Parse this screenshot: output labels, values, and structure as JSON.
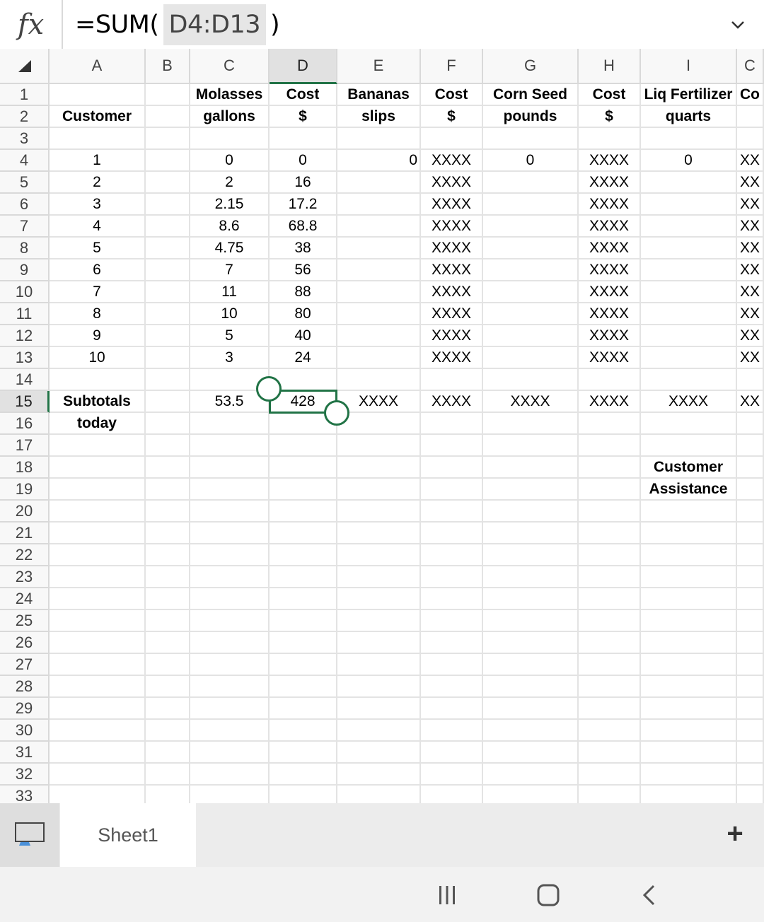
{
  "formula_bar": {
    "fx_label": "fx",
    "formula_prefix": "=SUM(",
    "formula_ref": "D4:D13",
    "formula_suffix": ")",
    "expand_icon": "chevron-down-icon"
  },
  "columns": [
    "A",
    "B",
    "C",
    "D",
    "E",
    "F",
    "G",
    "H",
    "I",
    "C"
  ],
  "selected_column": "D",
  "rows": [
    "1",
    "2",
    "3",
    "4",
    "5",
    "6",
    "7",
    "8",
    "9",
    "10",
    "11",
    "12",
    "13",
    "14",
    "15",
    "16",
    "17",
    "18",
    "19",
    "20",
    "21",
    "22",
    "23",
    "24",
    "25",
    "26",
    "27",
    "28",
    "29",
    "30",
    "31",
    "32",
    "33"
  ],
  "selected_row": "15",
  "headers": {
    "row1": [
      "",
      "",
      "Molasses",
      "Cost",
      "Bananas",
      "Cost",
      "Corn Seed",
      "Cost",
      "Liq Fertilizer",
      "Co"
    ],
    "row2": [
      "Customer",
      "",
      "gallons",
      "$",
      "slips",
      "$",
      "pounds",
      "$",
      "quarts",
      ""
    ]
  },
  "data_rows": [
    {
      "customer": "1",
      "molasses": "0",
      "cost": "0",
      "bananas": "0",
      "f": "XXXX",
      "corn": "0",
      "h": "XXXX",
      "liq": "0",
      "j": "XX"
    },
    {
      "customer": "2",
      "molasses": "2",
      "cost": "16",
      "bananas": "",
      "f": "XXXX",
      "corn": "",
      "h": "XXXX",
      "liq": "",
      "j": "XX"
    },
    {
      "customer": "3",
      "molasses": "2.15",
      "cost": "17.2",
      "bananas": "",
      "f": "XXXX",
      "corn": "",
      "h": "XXXX",
      "liq": "",
      "j": "XX"
    },
    {
      "customer": "4",
      "molasses": "8.6",
      "cost": "68.8",
      "bananas": "",
      "f": "XXXX",
      "corn": "",
      "h": "XXXX",
      "liq": "",
      "j": "XX"
    },
    {
      "customer": "5",
      "molasses": "4.75",
      "cost": "38",
      "bananas": "",
      "f": "XXXX",
      "corn": "",
      "h": "XXXX",
      "liq": "",
      "j": "XX"
    },
    {
      "customer": "6",
      "molasses": "7",
      "cost": "56",
      "bananas": "",
      "f": "XXXX",
      "corn": "",
      "h": "XXXX",
      "liq": "",
      "j": "XX"
    },
    {
      "customer": "7",
      "molasses": "11",
      "cost": "88",
      "bananas": "",
      "f": "XXXX",
      "corn": "",
      "h": "XXXX",
      "liq": "",
      "j": "XX"
    },
    {
      "customer": "8",
      "molasses": "10",
      "cost": "80",
      "bananas": "",
      "f": "XXXX",
      "corn": "",
      "h": "XXXX",
      "liq": "",
      "j": "XX"
    },
    {
      "customer": "9",
      "molasses": "5",
      "cost": "40",
      "bananas": "",
      "f": "XXXX",
      "corn": "",
      "h": "XXXX",
      "liq": "",
      "j": "XX"
    },
    {
      "customer": "10",
      "molasses": "3",
      "cost": "24",
      "bananas": "",
      "f": "XXXX",
      "corn": "",
      "h": "XXXX",
      "liq": "",
      "j": "XX"
    }
  ],
  "subtotals": {
    "label1": "Subtotals",
    "label2": "today",
    "values": [
      "53.5",
      "428",
      "XXXX",
      "XXXX",
      "XXXX",
      "XXXX",
      "XXXX",
      "XX"
    ]
  },
  "assistance": {
    "line1": "Customer",
    "line2": "Assistance"
  },
  "sheet_tabs": {
    "active": "Sheet1",
    "add_label": "+"
  },
  "nav": {
    "recent_icon": "recents-icon",
    "home_icon": "home-icon",
    "back_icon": "back-icon"
  },
  "colors": {
    "accent": "#217346",
    "gridline": "#e3e3e3",
    "header_bg": "#f8f8f8"
  }
}
